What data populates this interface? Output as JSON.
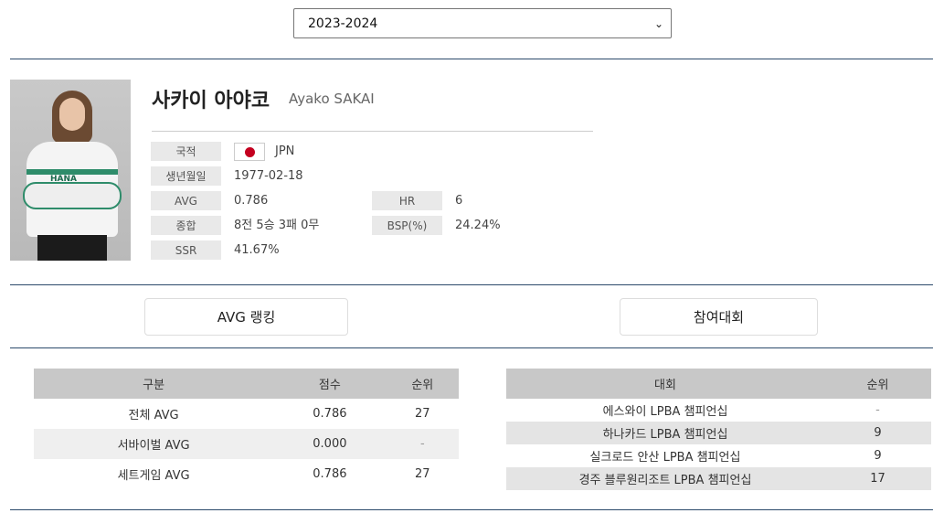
{
  "season": {
    "selected": "2023-2024"
  },
  "player": {
    "name_ko": "사카이 아야코",
    "name_en": "Ayako SAKAI",
    "nationality_label": "국적",
    "nationality": "JPN",
    "birth_label": "생년월일",
    "birth": "1977-02-18",
    "avg_label": "AVG",
    "avg": "0.786",
    "hr_label": "HR",
    "hr": "6",
    "record_label": "종합",
    "record": "8전 5승 3패 0무",
    "bsp_label": "BSP(%)",
    "bsp": "24.24%",
    "ssr_label": "SSR",
    "ssr": "41.67%"
  },
  "tabs": {
    "avg_ranking": "AVG 랭킹",
    "tournaments": "참여대회"
  },
  "avg_table": {
    "headers": [
      "구분",
      "점수",
      "순위"
    ],
    "rows": [
      [
        "전체 AVG",
        "0.786",
        "27"
      ],
      [
        "서바이벌 AVG",
        "0.000",
        "-"
      ],
      [
        "세트게임 AVG",
        "0.786",
        "27"
      ]
    ]
  },
  "tournament_table": {
    "headers": [
      "대회",
      "순위"
    ],
    "rows": [
      [
        "에스와이 LPBA 챔피언십",
        "-"
      ],
      [
        "하나카드 LPBA 챔피언십",
        "9"
      ],
      [
        "실크로드 안산 LPBA 챔피언십",
        "9"
      ],
      [
        "경주 블루원리조트 LPBA 챔피언십",
        "17"
      ]
    ]
  },
  "icons": {
    "select": "chevron-down-icon",
    "flag": "japan-flag-icon"
  },
  "colors": {
    "divider": "#2c4a6b",
    "label_bg": "#e9e9e9",
    "table_header": "#c8c8c8"
  }
}
